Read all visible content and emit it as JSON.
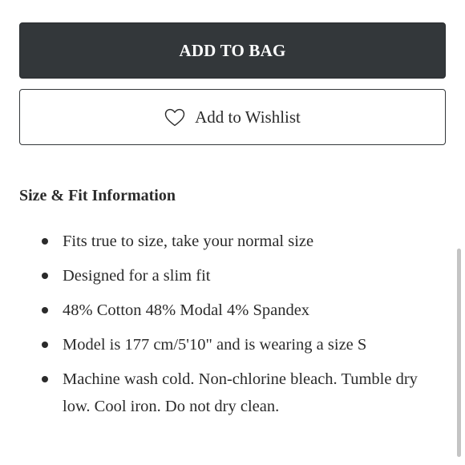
{
  "buttons": {
    "add_to_bag": "ADD TO BAG",
    "add_to_wishlist": "Add to Wishlist"
  },
  "size_fit": {
    "title": "Size & Fit Information",
    "items": [
      "Fits true to size, take your normal size",
      "Designed for a slim fit",
      "48% Cotton 48% Modal 4% Spandex",
      "Model is 177 cm/5'10\" and is wearing a size S",
      "Machine wash cold. Non-chlorine bleach. Tumble dry low. Cool iron. Do not dry clean."
    ]
  },
  "colors": {
    "primary_button_bg": "#33373a",
    "text": "#2b2b2b"
  }
}
